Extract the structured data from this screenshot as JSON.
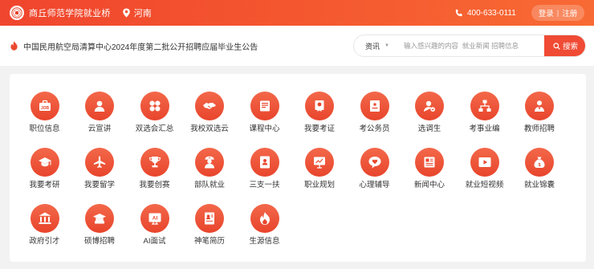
{
  "header": {
    "site_name": "商丘师范学院就业桥",
    "location": "河南",
    "phone": "400-633-0111",
    "login_label": "登录",
    "separator": "|",
    "register_label": "注册"
  },
  "notice": {
    "text": "中国民用航空局清算中心2024年度第二批公开招聘应届毕业生公告"
  },
  "search": {
    "category": "资讯",
    "placeholder": "输入感兴趣的内容  就业新闻 招聘信息",
    "button_label": "搜索"
  },
  "services": {
    "items": [
      {
        "label": "职位信息",
        "icon": "job-icon"
      },
      {
        "label": "云宣讲",
        "icon": "user-icon"
      },
      {
        "label": "双选会汇总",
        "icon": "grid-icon"
      },
      {
        "label": "我校双选云",
        "icon": "handshake-icon"
      },
      {
        "label": "课程中心",
        "icon": "book-icon"
      },
      {
        "label": "我要考证",
        "icon": "certificate-icon"
      },
      {
        "label": "考公务员",
        "icon": "civil-servant-icon"
      },
      {
        "label": "选调生",
        "icon": "selection-icon"
      },
      {
        "label": "考事业编",
        "icon": "org-chart-icon"
      },
      {
        "label": "教师招聘",
        "icon": "teacher-icon"
      },
      {
        "label": "我要考研",
        "icon": "graduation-cap-icon"
      },
      {
        "label": "我要留学",
        "icon": "airplane-icon"
      },
      {
        "label": "我要创赛",
        "icon": "trophy-icon"
      },
      {
        "label": "部队就业",
        "icon": "soldier-icon"
      },
      {
        "label": "三支一扶",
        "icon": "document-person-icon"
      },
      {
        "label": "职业规划",
        "icon": "chart-board-icon"
      },
      {
        "label": "心理辅导",
        "icon": "heart-chat-icon"
      },
      {
        "label": "新闻中心",
        "icon": "newspaper-icon"
      },
      {
        "label": "就业短视频",
        "icon": "video-icon"
      },
      {
        "label": "就业锦囊",
        "icon": "bag-icon"
      },
      {
        "label": "政府引才",
        "icon": "government-icon"
      },
      {
        "label": "硕博招聘",
        "icon": "doctor-cap-icon"
      },
      {
        "label": "AI面试",
        "icon": "ai-interview-icon"
      },
      {
        "label": "神笔简历",
        "icon": "resume-icon"
      },
      {
        "label": "生源信息",
        "icon": "flame-icon"
      }
    ]
  }
}
